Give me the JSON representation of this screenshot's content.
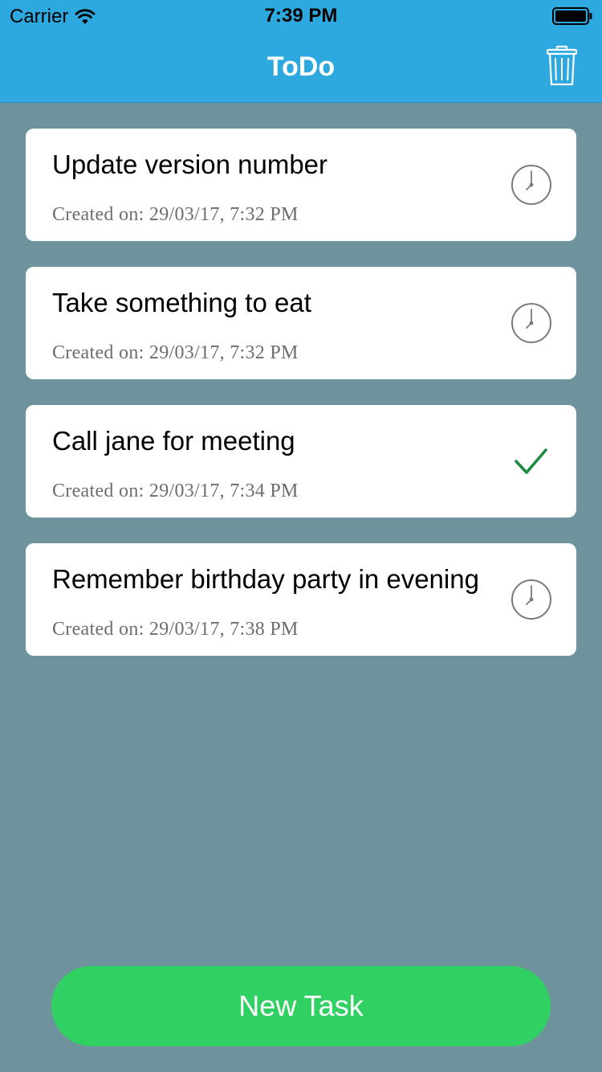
{
  "status_bar": {
    "carrier": "Carrier",
    "time": "7:39 PM",
    "wifi_icon": "wifi-icon",
    "battery_icon": "battery-full-icon"
  },
  "nav": {
    "title": "ToDo",
    "delete_icon": "trash-icon"
  },
  "tasks": [
    {
      "title": "Update version number",
      "created": "Created on: 29/03/17, 7:32 PM",
      "status": "pending",
      "icon": "clock-icon"
    },
    {
      "title": "Take something to eat",
      "created": "Created on: 29/03/17, 7:32 PM",
      "status": "pending",
      "icon": "clock-icon"
    },
    {
      "title": "Call jane for meeting",
      "created": "Created on: 29/03/17, 7:34 PM",
      "status": "done",
      "icon": "checkmark-icon"
    },
    {
      "title": "Remember birthday party in evening",
      "created": "Created on: 29/03/17, 7:38 PM",
      "status": "pending",
      "icon": "clock-icon"
    }
  ],
  "new_task_button": {
    "label": "New Task"
  },
  "colors": {
    "nav_bar": "#2ea9df",
    "background": "#6e939c",
    "card": "#ffffff",
    "button": "#30d162",
    "check": "#1a8a3c",
    "clock": "#7a7a7a"
  }
}
